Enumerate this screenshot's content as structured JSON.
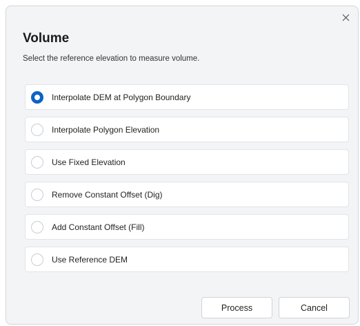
{
  "dialog": {
    "title": "Volume",
    "subtitle": "Select the reference elevation to measure volume.",
    "close_icon": "close-icon",
    "options": [
      {
        "label": "Interpolate DEM at Polygon Boundary",
        "checked": true
      },
      {
        "label": "Interpolate Polygon Elevation",
        "checked": false
      },
      {
        "label": "Use Fixed Elevation",
        "checked": false
      },
      {
        "label": "Remove Constant Offset (Dig)",
        "checked": false
      },
      {
        "label": "Add Constant Offset (Fill)",
        "checked": false
      },
      {
        "label": "Use Reference DEM",
        "checked": false
      }
    ],
    "buttons": {
      "process_label": "Process",
      "cancel_label": "Cancel"
    }
  },
  "colors": {
    "accent": "#0b63c5",
    "dialog_background": "#f3f4f6",
    "option_background": "#ffffff"
  }
}
